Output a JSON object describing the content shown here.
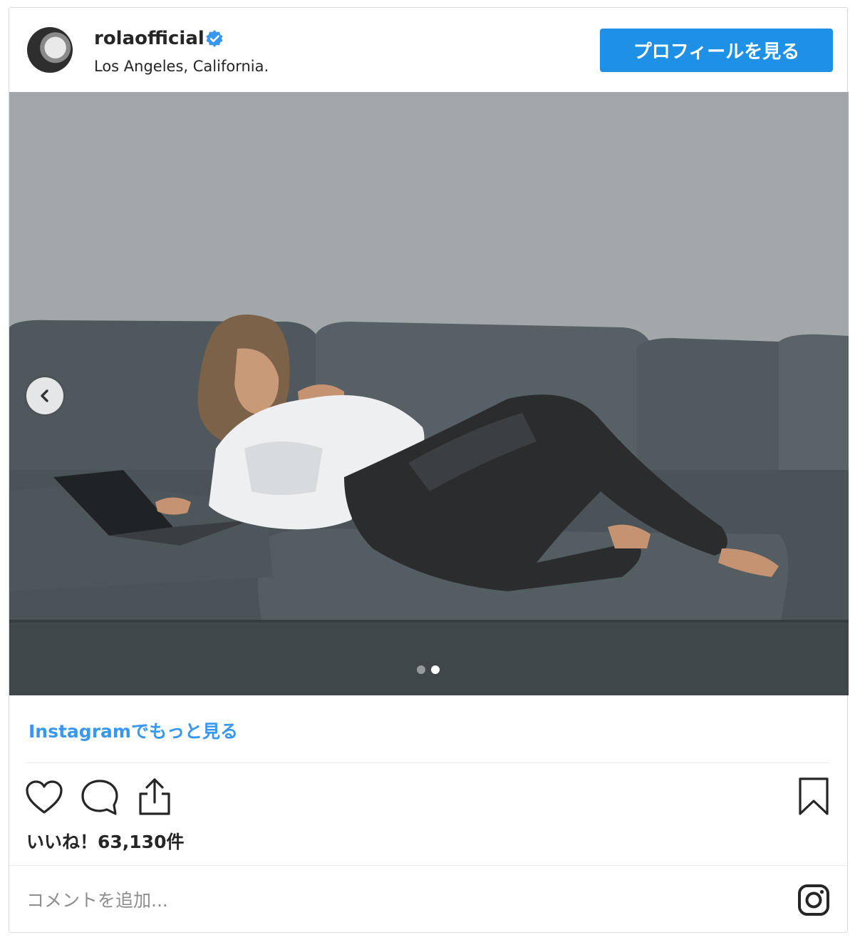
{
  "post": {
    "username": "rolaofficial",
    "location": "Los Angeles, California.",
    "profile_button": "プロフィールを見る",
    "more_link": "Instagramでもっと見る",
    "likes": "いいね！63,130件",
    "comment_placeholder": "コメントを追加...",
    "carousel": {
      "count": 2,
      "active_index": 1
    }
  },
  "colors": {
    "accent": "#1e90e6",
    "link": "#3897f0",
    "verified": "#3897f0"
  },
  "icons": [
    "verified-badge-icon",
    "chevron-left-icon",
    "heart-icon",
    "comment-icon",
    "share-icon",
    "bookmark-icon",
    "instagram-logo-icon"
  ]
}
